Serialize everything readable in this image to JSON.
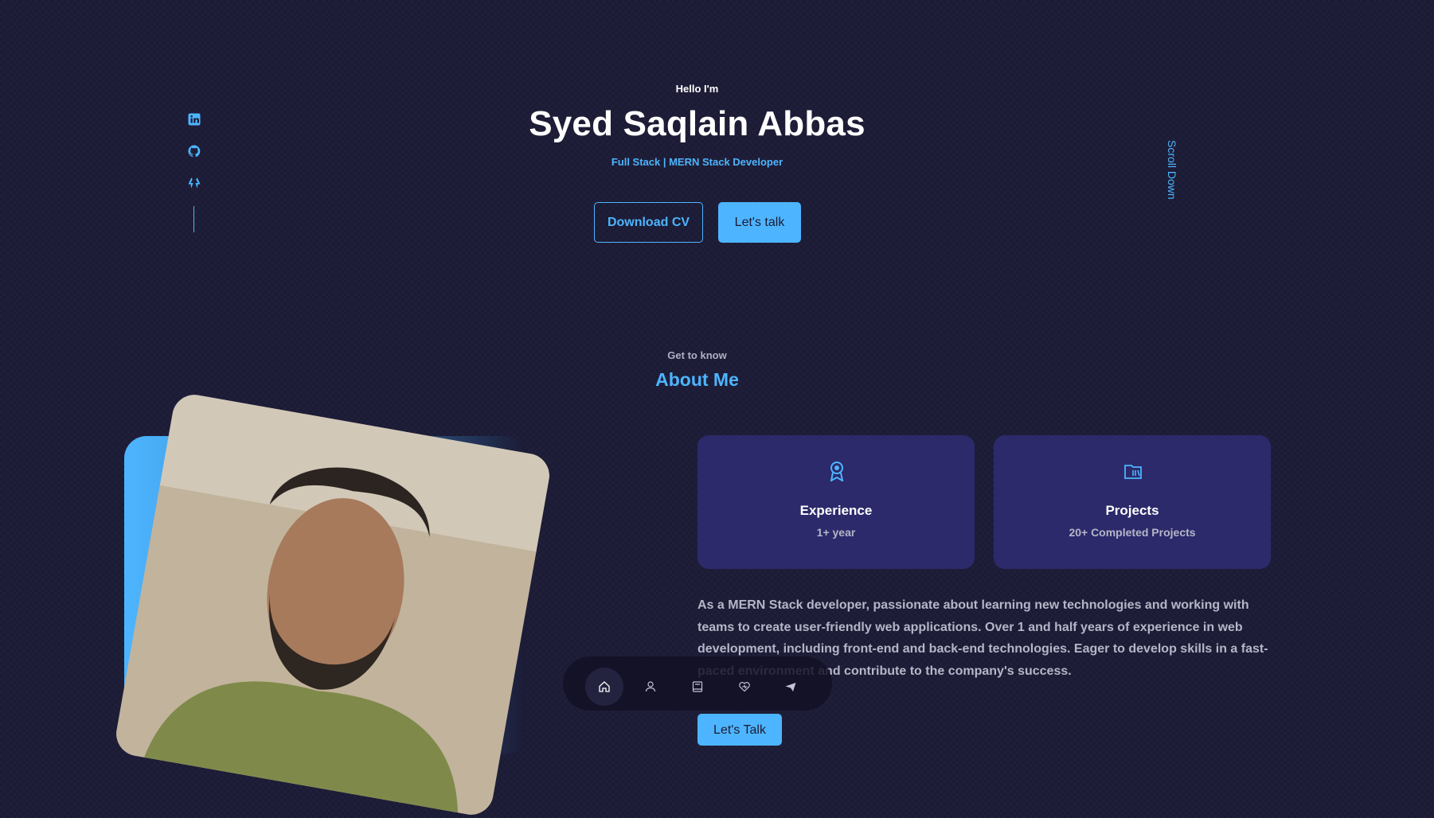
{
  "hero": {
    "greeting": "Hello I'm",
    "name": "Syed Saqlain Abbas",
    "role": "Full Stack | MERN Stack Developer",
    "download_cv_label": "Download CV",
    "lets_talk_label": "Let's talk",
    "scroll_down_label": "Scroll Down"
  },
  "socials": [
    {
      "icon": "linkedin-icon"
    },
    {
      "icon": "github-icon"
    },
    {
      "icon": "codepen-icon"
    }
  ],
  "about": {
    "eyebrow": "Get to know",
    "title": "About Me",
    "cards": [
      {
        "icon": "award-icon",
        "title": "Experience",
        "subtitle": "1+ year"
      },
      {
        "icon": "folder-icon",
        "title": "Projects",
        "subtitle": "20+ Completed Projects"
      }
    ],
    "description": "As a MERN Stack developer, passionate about learning new technologies and working with teams to create user-friendly web applications. Over 1 and half years of experience in web development, including front-end and back-end technologies. Eager to develop skills in a fast-paced environment and contribute to the company's success.",
    "lets_talk_label": "Let's Talk"
  },
  "bottom_nav": [
    {
      "icon": "home-icon",
      "active": true
    },
    {
      "icon": "user-icon",
      "active": false
    },
    {
      "icon": "book-icon",
      "active": false
    },
    {
      "icon": "services-icon",
      "active": false
    },
    {
      "icon": "send-icon",
      "active": false
    }
  ],
  "colors": {
    "background": "#1c1b35",
    "accent": "#4db5ff",
    "card": "#2c2a6b",
    "muted_text": "#b5b6c8"
  }
}
